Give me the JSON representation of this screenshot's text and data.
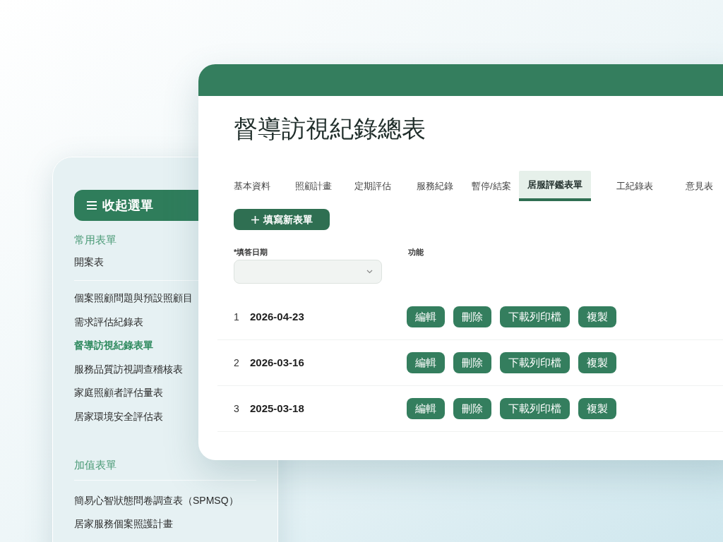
{
  "sidebar": {
    "menu_button": "收起選單",
    "sections": [
      {
        "title": "常用表單",
        "items": [
          {
            "label": "開案表",
            "selected": false
          }
        ]
      },
      {
        "items": [
          {
            "label": "個案照顧問題與預設照顧目",
            "selected": false
          },
          {
            "label": "需求評估紀錄表",
            "selected": false
          },
          {
            "label": "督導訪視紀錄表單",
            "selected": true
          },
          {
            "label": "服務品質訪視調查稽核表",
            "selected": false
          },
          {
            "label": "家庭照顧者評估量表",
            "selected": false
          },
          {
            "label": "居家環境安全評估表",
            "selected": false
          }
        ]
      },
      {
        "title": "加值表單",
        "items": [
          {
            "label": "簡易心智狀態問卷調查表（SPMSQ）",
            "selected": false
          },
          {
            "label": "居家服務個案照護計畫",
            "selected": false
          }
        ]
      }
    ]
  },
  "main": {
    "title": "督導訪視紀錄總表",
    "tabs": [
      {
        "label": "基本資料",
        "selected": false
      },
      {
        "label": "照顧計畫",
        "selected": false
      },
      {
        "label": "定期評估",
        "selected": false
      },
      {
        "label": "服務紀錄",
        "selected": false
      },
      {
        "label": "暫停/結案",
        "selected": false
      },
      {
        "label": "居服評鑑表單",
        "selected": true
      },
      {
        "label": "工紀錄表",
        "selected": false
      },
      {
        "label": "意見表",
        "selected": false
      }
    ],
    "new_button": "填寫新表單",
    "date_label": "*填答日期",
    "actions_label": "功能",
    "rows": [
      {
        "index": "1",
        "date": "2026-04-23",
        "actions": [
          "編輯",
          "刪除",
          "下載列印檔",
          "複製"
        ]
      },
      {
        "index": "2",
        "date": "2026-03-16",
        "actions": [
          "編輯",
          "刪除",
          "下載列印檔",
          "複製"
        ]
      },
      {
        "index": "3",
        "date": "2025-03-18",
        "actions": [
          "編輯",
          "刪除",
          "下載列印檔",
          "複製"
        ]
      }
    ]
  }
}
